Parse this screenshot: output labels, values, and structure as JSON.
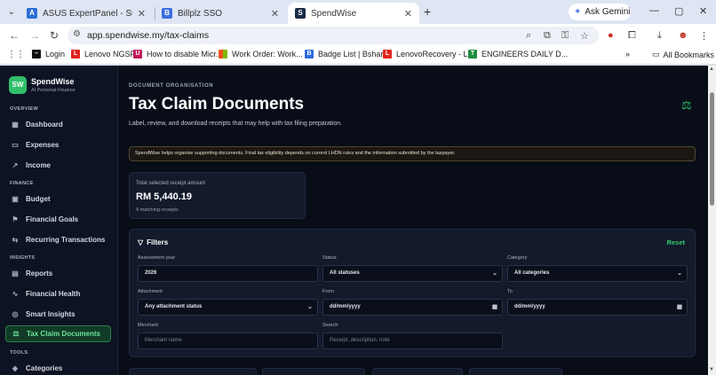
{
  "browser": {
    "tabs": [
      {
        "label": "ASUS ExpertPanel - Support",
        "favicon": "asus-icon"
      },
      {
        "label": "Billplz SSO",
        "favicon": "billplz-icon"
      },
      {
        "label": "SpendWise",
        "favicon": "spendwise-icon"
      }
    ],
    "gemini_label": "Ask Gemini",
    "url": "app.spendwise.my/tax-claims",
    "bookmarks": [
      "Login",
      "Lenovo NGSP",
      "How to disable Micr...",
      "Work Order: Work...",
      "Badge List | Bsharp",
      "LenovoRecovery - L...",
      "ENGINEERS DAILY D..."
    ],
    "all_bookmarks": "All Bookmarks"
  },
  "brand": {
    "logo": "SW",
    "name": "SpendWise",
    "tagline": "AI Personal Finance"
  },
  "sidebar": {
    "sections": [
      {
        "title": "OVERVIEW",
        "items": [
          {
            "label": "Dashboard",
            "icon": "grid-icon"
          },
          {
            "label": "Expenses",
            "icon": "card-icon"
          },
          {
            "label": "Income",
            "icon": "trend-up-icon"
          }
        ]
      },
      {
        "title": "FINANCE",
        "items": [
          {
            "label": "Budget",
            "icon": "wallet-icon"
          },
          {
            "label": "Financial Goals",
            "icon": "target-icon"
          },
          {
            "label": "Recurring Transactions",
            "icon": "repeat-icon"
          }
        ]
      },
      {
        "title": "INSIGHTS",
        "items": [
          {
            "label": "Reports",
            "icon": "document-icon"
          },
          {
            "label": "Financial Health",
            "icon": "pulse-icon"
          },
          {
            "label": "Smart Insights",
            "icon": "lightbulb-icon"
          },
          {
            "label": "Tax Claim Documents",
            "icon": "scale-icon",
            "active": true
          }
        ]
      },
      {
        "title": "TOOLS",
        "items": [
          {
            "label": "Categories",
            "icon": "tag-icon"
          }
        ]
      }
    ]
  },
  "page": {
    "eyebrow": "DOCUMENT ORGANISATION",
    "title": "Tax Claim Documents",
    "subtitle": "Label, review, and download receipts that may help with tax filing preparation.",
    "notice": "SpendWise helps organise supporting documents. Final tax eligibility depends on current LHDN rules and the information submitted by the taxpayer."
  },
  "summary": {
    "label": "Total selected receipt amount",
    "amount": "RM 5,440.19",
    "count": "9 matching receipts"
  },
  "filters": {
    "title": "Filters",
    "reset": "Reset",
    "assessment_year": {
      "label": "Assessment year",
      "value": "2026"
    },
    "status": {
      "label": "Status",
      "value": "All statuses"
    },
    "category": {
      "label": "Category",
      "value": "All categories"
    },
    "attachment": {
      "label": "Attachment",
      "value": "Any attachment status"
    },
    "from": {
      "label": "From",
      "value": "dd/mm/yyyy"
    },
    "to": {
      "label": "To",
      "value": "dd/mm/yyyy"
    },
    "merchant": {
      "label": "Merchant",
      "placeholder": "Merchant name"
    },
    "search": {
      "label": "Search",
      "placeholder": "Receipt, description, note"
    }
  },
  "colors": {
    "accent": "#2fbf6a",
    "background": "#080d17",
    "sidebar": "#0d1322",
    "card": "#121a2b"
  }
}
